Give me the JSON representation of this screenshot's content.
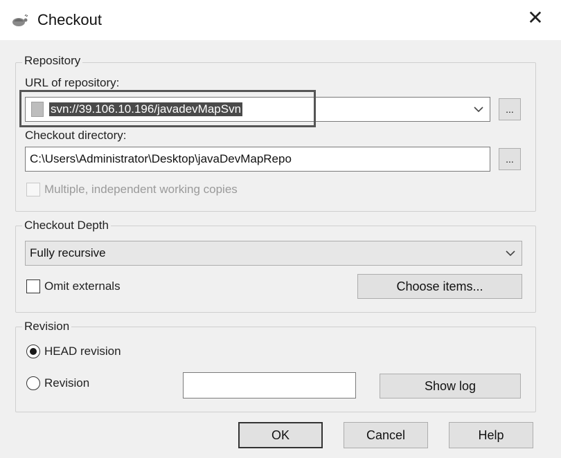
{
  "window": {
    "title": "Checkout",
    "icon": "tortoise-svn-icon",
    "close_glyph": "✕"
  },
  "repository": {
    "group_label": "Repository",
    "url_label": "URL of repository:",
    "url_value": "svn://39.106.10.196/javadevMapSvn",
    "browse_url_label": "...",
    "dir_label": "Checkout directory:",
    "dir_value": "C:\\Users\\Administrator\\Desktop\\javaDevMapRepo",
    "browse_dir_label": "...",
    "multiple_copies_label": "Multiple, independent working copies",
    "multiple_copies_checked": false,
    "multiple_copies_enabled": false
  },
  "depth": {
    "group_label": "Checkout Depth",
    "selected": "Fully recursive",
    "omit_externals_label": "Omit externals",
    "omit_externals_checked": false,
    "choose_items_label": "Choose items..."
  },
  "revision": {
    "group_label": "Revision",
    "head_label": "HEAD revision",
    "head_selected": true,
    "revision_label": "Revision",
    "revision_value": "",
    "show_log_label": "Show log"
  },
  "buttons": {
    "ok": "OK",
    "cancel": "Cancel",
    "help": "Help"
  }
}
